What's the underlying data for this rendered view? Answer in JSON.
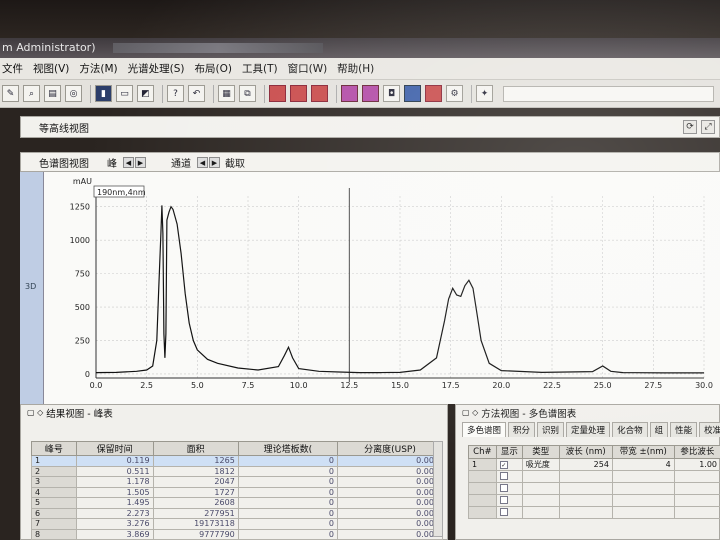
{
  "window": {
    "title": "m Administrator)"
  },
  "menu": [
    "文件",
    "视图(V)",
    "方法(M)",
    "光谱处理(S)",
    "布局(O)",
    "工具(T)",
    "窗口(W)",
    "帮助(H)"
  ],
  "contour_panel": {
    "title": "等高线视图"
  },
  "chrom_panel": {
    "title": "色谱图视图",
    "peak_label": "峰",
    "channel_label": "通道",
    "extract_label": "截取",
    "side_tag": "3D"
  },
  "chart_data": {
    "type": "line",
    "ylabel": "mAU",
    "channel_label": "190nm,4nm",
    "xlim": [
      0.0,
      30.0
    ],
    "ylim": [
      -30,
      1330
    ],
    "x_ticks": [
      "0.0",
      "2.5",
      "5.0",
      "7.5",
      "10.0",
      "12.5",
      "15.0",
      "17.5",
      "20.0",
      "22.5",
      "25.0",
      "27.5",
      "30.0"
    ],
    "y_ticks": [
      "0",
      "250",
      "500",
      "750",
      "1000",
      "1250"
    ],
    "series": [
      {
        "x": [
          0,
          1.0,
          2.0,
          2.5,
          2.8,
          3.0,
          3.1,
          3.2,
          3.25,
          3.3,
          3.35,
          3.4,
          3.45,
          3.5,
          3.6,
          3.7,
          3.8,
          4.0,
          4.2,
          4.4,
          4.6,
          4.8,
          5.0,
          5.5,
          6.0,
          7.0,
          8.0,
          9.0,
          9.3,
          9.5,
          9.7,
          10.0,
          11.0,
          12.0,
          13.0,
          14.0,
          15.0,
          16.0,
          16.8,
          17.2,
          17.4,
          17.6,
          17.8,
          18.0,
          18.2,
          18.4,
          18.6,
          18.8,
          19.0,
          19.4,
          20.0,
          22.0,
          24.5,
          25.0,
          25.4,
          26.0,
          28.0,
          30.0
        ],
        "y": [
          10,
          12,
          20,
          30,
          60,
          250,
          650,
          1050,
          1260,
          1050,
          300,
          120,
          300,
          1150,
          1210,
          1250,
          1230,
          1120,
          900,
          600,
          380,
          250,
          180,
          110,
          80,
          45,
          30,
          55,
          140,
          200,
          120,
          40,
          20,
          15,
          10,
          10,
          12,
          30,
          120,
          400,
          560,
          640,
          590,
          580,
          660,
          700,
          640,
          450,
          250,
          80,
          25,
          12,
          18,
          60,
          20,
          10,
          8,
          8
        ]
      }
    ],
    "legend": "none",
    "grid": true
  },
  "results_panel": {
    "title": "结果视图 - 峰表",
    "columns": [
      "峰号",
      "保留时间",
      "面积",
      "理论塔板数(",
      "分离度(USP)"
    ],
    "rows": [
      [
        "1",
        "0.119",
        "1265",
        "0",
        "0.000"
      ],
      [
        "2",
        "0.511",
        "1812",
        "0",
        "0.000"
      ],
      [
        "3",
        "1.178",
        "2047",
        "0",
        "0.000"
      ],
      [
        "4",
        "1.505",
        "1727",
        "0",
        "0.000"
      ],
      [
        "5",
        "1.495",
        "2608",
        "0",
        "0.000"
      ],
      [
        "6",
        "2.273",
        "277951",
        "0",
        "0.000"
      ],
      [
        "7",
        "3.276",
        "19173118",
        "0",
        "0.000"
      ],
      [
        "8",
        "3.869",
        "9777790",
        "0",
        "0.000"
      ]
    ]
  },
  "method_panel": {
    "title": "方法视图 - 多色谱图表",
    "tabs": [
      "多色谱图",
      "积分",
      "识别",
      "定量处理",
      "化合物",
      "组",
      "性能",
      "校准"
    ],
    "columns": [
      "Ch#",
      "显示",
      "类型",
      "波长 (nm)",
      "带宽 ±(nm)",
      "参比波长"
    ],
    "rows": [
      [
        "1",
        "✓",
        "吸光度",
        "254",
        "4",
        "1.00"
      ],
      [
        "",
        "",
        "",
        "",
        "",
        ""
      ],
      [
        "",
        "",
        "",
        "",
        "",
        ""
      ],
      [
        "",
        "",
        "",
        "",
        "",
        ""
      ],
      [
        "",
        "",
        "",
        "",
        "",
        ""
      ]
    ]
  }
}
